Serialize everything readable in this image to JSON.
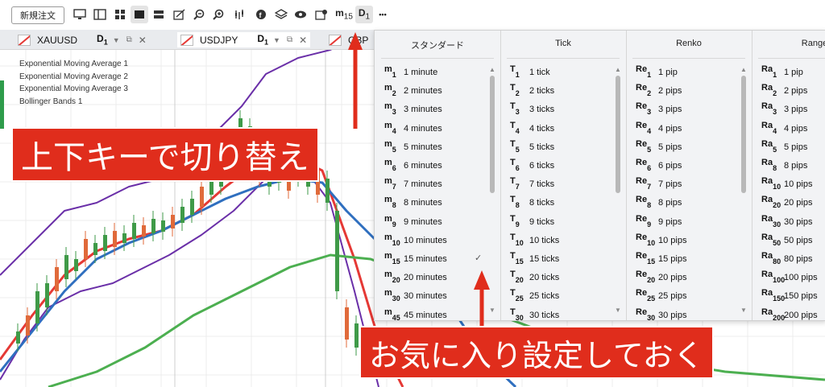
{
  "toolbar": {
    "order_label": "新規注文",
    "icons": [
      "monitor-icon",
      "panel-icon",
      "grid-icon",
      "single-chart-icon",
      "split-chart-icon",
      "drawing-icon",
      "zoom-out-icon",
      "zoom-in-icon",
      "indicators-icon",
      "trading-icon",
      "layers-icon",
      "eye-icon",
      "settings-icon"
    ],
    "tf_m": "m",
    "tf_m_num": "15",
    "tf_d": "D",
    "tf_d_num": "1",
    "more": "•••"
  },
  "tabs": [
    {
      "symbol": "XAUUSD",
      "tf": "D",
      "tf_num": "1"
    },
    {
      "symbol": "USDJPY",
      "tf": "D",
      "tf_num": "1"
    },
    {
      "symbol": "GBP",
      "tf": "",
      "tf_num": ""
    }
  ],
  "indicators": [
    "Exponential Moving Average 1",
    "Exponential Moving Average 2",
    "Exponential Moving Average 3",
    "Bollinger Bands 1"
  ],
  "dropdown": {
    "columns": [
      {
        "title": "スタンダード",
        "items": [
          {
            "ic": "m",
            "sub": "1",
            "label": "1 minute"
          },
          {
            "ic": "m",
            "sub": "2",
            "label": "2 minutes"
          },
          {
            "ic": "m",
            "sub": "3",
            "label": "3 minutes"
          },
          {
            "ic": "m",
            "sub": "4",
            "label": "4 minutes"
          },
          {
            "ic": "m",
            "sub": "5",
            "label": "5 minutes"
          },
          {
            "ic": "m",
            "sub": "6",
            "label": "6 minutes"
          },
          {
            "ic": "m",
            "sub": "7",
            "label": "7 minutes"
          },
          {
            "ic": "m",
            "sub": "8",
            "label": "8 minutes"
          },
          {
            "ic": "m",
            "sub": "9",
            "label": "9 minutes"
          },
          {
            "ic": "m",
            "sub": "10",
            "label": "10 minutes"
          },
          {
            "ic": "m",
            "sub": "15",
            "label": "15 minutes"
          },
          {
            "ic": "m",
            "sub": "20",
            "label": "20 minutes"
          },
          {
            "ic": "m",
            "sub": "30",
            "label": "30 minutes"
          },
          {
            "ic": "m",
            "sub": "45",
            "label": "45 minutes"
          }
        ],
        "checked_index": 10
      },
      {
        "title": "Tick",
        "items": [
          {
            "ic": "T",
            "sub": "1",
            "label": "1 tick"
          },
          {
            "ic": "T",
            "sub": "2",
            "label": "2 ticks"
          },
          {
            "ic": "T",
            "sub": "3",
            "label": "3 ticks"
          },
          {
            "ic": "T",
            "sub": "4",
            "label": "4 ticks"
          },
          {
            "ic": "T",
            "sub": "5",
            "label": "5 ticks"
          },
          {
            "ic": "T",
            "sub": "6",
            "label": "6 ticks"
          },
          {
            "ic": "T",
            "sub": "7",
            "label": "7 ticks"
          },
          {
            "ic": "T",
            "sub": "8",
            "label": "8 ticks"
          },
          {
            "ic": "T",
            "sub": "9",
            "label": "9 ticks"
          },
          {
            "ic": "T",
            "sub": "10",
            "label": "10 ticks"
          },
          {
            "ic": "T",
            "sub": "15",
            "label": "15 ticks"
          },
          {
            "ic": "T",
            "sub": "20",
            "label": "20 ticks"
          },
          {
            "ic": "T",
            "sub": "25",
            "label": "25 ticks"
          },
          {
            "ic": "T",
            "sub": "30",
            "label": "30 ticks"
          }
        ]
      },
      {
        "title": "Renko",
        "items": [
          {
            "ic": "Re",
            "sub": "1",
            "label": "1 pip"
          },
          {
            "ic": "Re",
            "sub": "2",
            "label": "2 pips"
          },
          {
            "ic": "Re",
            "sub": "3",
            "label": "3 pips"
          },
          {
            "ic": "Re",
            "sub": "4",
            "label": "4 pips"
          },
          {
            "ic": "Re",
            "sub": "5",
            "label": "5 pips"
          },
          {
            "ic": "Re",
            "sub": "6",
            "label": "6 pips"
          },
          {
            "ic": "Re",
            "sub": "7",
            "label": "7 pips"
          },
          {
            "ic": "Re",
            "sub": "8",
            "label": "8 pips"
          },
          {
            "ic": "Re",
            "sub": "9",
            "label": "9 pips"
          },
          {
            "ic": "Re",
            "sub": "10",
            "label": "10 pips"
          },
          {
            "ic": "Re",
            "sub": "15",
            "label": "15 pips"
          },
          {
            "ic": "Re",
            "sub": "20",
            "label": "20 pips"
          },
          {
            "ic": "Re",
            "sub": "25",
            "label": "25 pips"
          },
          {
            "ic": "Re",
            "sub": "30",
            "label": "30 pips"
          }
        ]
      },
      {
        "title": "Range",
        "items": [
          {
            "ic": "Ra",
            "sub": "1",
            "label": "1 pip"
          },
          {
            "ic": "Ra",
            "sub": "2",
            "label": "2 pips"
          },
          {
            "ic": "Ra",
            "sub": "3",
            "label": "3 pips"
          },
          {
            "ic": "Ra",
            "sub": "4",
            "label": "4 pips"
          },
          {
            "ic": "Ra",
            "sub": "5",
            "label": "5 pips"
          },
          {
            "ic": "Ra",
            "sub": "8",
            "label": "8 pips"
          },
          {
            "ic": "Ra",
            "sub": "10",
            "label": "10 pips"
          },
          {
            "ic": "Ra",
            "sub": "20",
            "label": "20 pips"
          },
          {
            "ic": "Ra",
            "sub": "30",
            "label": "30 pips"
          },
          {
            "ic": "Ra",
            "sub": "50",
            "label": "50 pips"
          },
          {
            "ic": "Ra",
            "sub": "80",
            "label": "80 pips"
          },
          {
            "ic": "Ra",
            "sub": "100",
            "label": "100 pips"
          },
          {
            "ic": "Ra",
            "sub": "150",
            "label": "150 pips"
          },
          {
            "ic": "Ra",
            "sub": "200",
            "label": "200 pips"
          }
        ]
      }
    ]
  },
  "annotations": {
    "top": "上下キーで切り替え",
    "bottom": "お気に入り設定しておく"
  },
  "colors": {
    "accent_red": "#e02d1c",
    "ema_fast": "#e53935",
    "ema_mid": "#2f6fbf",
    "ema_slow": "#4caf50",
    "bollinger": "#6a2fa8",
    "candle_up": "#3f9a48",
    "candle_down": "#e06a3a"
  }
}
